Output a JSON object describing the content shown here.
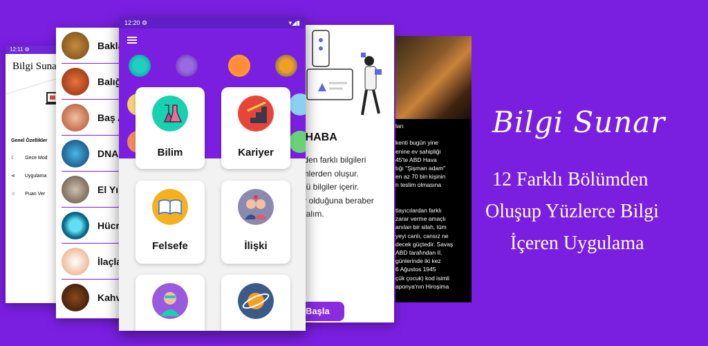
{
  "settings_screen": {
    "time": "12:11",
    "title": "Bilgi Sunar",
    "section": "Genel Özellikler",
    "items": [
      "Gece Mod",
      "Uygulama",
      "Puan Ver"
    ]
  },
  "list_screen": {
    "items": [
      "Bakla",
      "Balığ",
      "Baş A",
      "DNA",
      "El Yık",
      "Hücr",
      "İlaçla",
      "Kahv"
    ]
  },
  "main_screen": {
    "time": "12:20",
    "cards": [
      "Bilim",
      "Kariyer",
      "Felsefe",
      "İlişki"
    ]
  },
  "welcome_screen": {
    "greeting": "RHABA",
    "lines": [
      "inden farklı bilgileri",
      "ümlerden oluşur.",
      "zgü bilgiler içerir.",
      "ler olduğuna beraber",
      "akalım."
    ],
    "start_button": "Başla"
  },
  "article_screen": {
    "lines": [
      "ları",
      "",
      "kenti bugün yine",
      "enine ev sahipliği",
      "45'te ABD Hava",
      "tığı \"Şişman adam\"",
      "en az 70 bin kişinin",
      "n teslim olmasına",
      "",
      "",
      "tlayıcılardan farklı",
      "zarar verme amaçlı",
      "anılan bir silah, tüm",
      "yeyi canlı, cansız ne",
      "decek güçtedir. Savaş",
      "ABD tarafından II.",
      "günlerinde iki kez",
      "6 Ağustos 1945",
      "çük çocuk) kod isimli",
      "aponya'nın Hiroşima"
    ]
  },
  "promo": {
    "brand": "Bilgi Sunar",
    "line1": "12 Farklı Bölümden",
    "line2": "Oluşup Yüzlerce Bilgi",
    "line3": "İçeren Uygulama"
  },
  "colors": {
    "background": "#7a1fe0",
    "accent": "#8a2be2"
  }
}
